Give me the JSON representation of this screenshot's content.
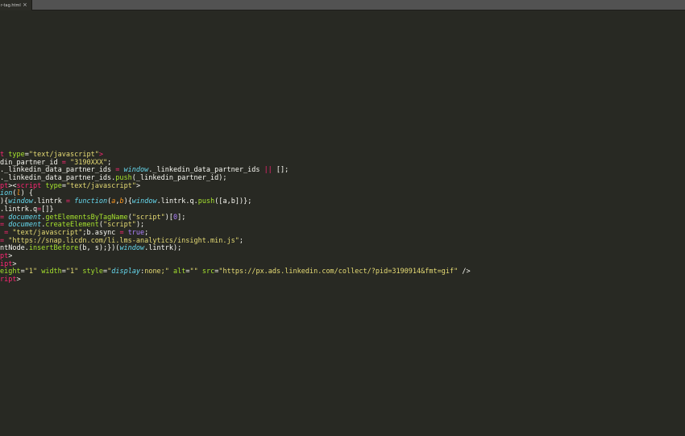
{
  "tab": {
    "label": "r-tag.html",
    "close_glyph": "×"
  },
  "code_lines": [
    [
      {
        "c": "tag",
        "t": "t"
      },
      {
        "c": "text",
        "t": " "
      },
      {
        "c": "attr",
        "t": "type"
      },
      {
        "c": "text",
        "t": "="
      },
      {
        "c": "str",
        "t": "\"text/javascript\""
      },
      {
        "c": "tag",
        "t": ">"
      }
    ],
    [
      {
        "c": "text",
        "t": "din_partner_id "
      },
      {
        "c": "op",
        "t": "="
      },
      {
        "c": "text",
        "t": " "
      },
      {
        "c": "str",
        "t": "\"3190XXX\""
      },
      {
        "c": "text",
        "t": ";"
      }
    ],
    [
      {
        "c": "text",
        "t": "._linkedin_data_partner_ids "
      },
      {
        "c": "op",
        "t": "="
      },
      {
        "c": "text",
        "t": " "
      },
      {
        "c": "global",
        "t": "window"
      },
      {
        "c": "text",
        "t": "._linkedin_data_partner_ids "
      },
      {
        "c": "op",
        "t": "||"
      },
      {
        "c": "text",
        "t": " [];"
      }
    ],
    [
      {
        "c": "text",
        "t": "._linkedin_data_partner_ids."
      },
      {
        "c": "func",
        "t": "push"
      },
      {
        "c": "text",
        "t": "(_linkedin_partner_id);"
      }
    ],
    [
      {
        "c": "tag",
        "t": "pt"
      },
      {
        "c": "text",
        "t": "><"
      },
      {
        "c": "tag",
        "t": "script"
      },
      {
        "c": "text",
        "t": " "
      },
      {
        "c": "attr",
        "t": "type"
      },
      {
        "c": "text",
        "t": "="
      },
      {
        "c": "str",
        "t": "\"text/javascript\""
      },
      {
        "c": "text",
        "t": ">"
      }
    ],
    [
      {
        "c": "kw",
        "t": "ion"
      },
      {
        "c": "text",
        "t": "("
      },
      {
        "c": "param",
        "t": "l"
      },
      {
        "c": "text",
        "t": ") {"
      }
    ],
    [
      {
        "c": "text",
        "t": "){"
      },
      {
        "c": "global",
        "t": "window"
      },
      {
        "c": "text",
        "t": ".lintrk "
      },
      {
        "c": "op",
        "t": "="
      },
      {
        "c": "text",
        "t": " "
      },
      {
        "c": "kw",
        "t": "function"
      },
      {
        "c": "text",
        "t": "("
      },
      {
        "c": "param",
        "t": "a"
      },
      {
        "c": "text",
        "t": ","
      },
      {
        "c": "param",
        "t": "b"
      },
      {
        "c": "text",
        "t": "){"
      },
      {
        "c": "global",
        "t": "window"
      },
      {
        "c": "text",
        "t": ".lintrk.q."
      },
      {
        "c": "func",
        "t": "push"
      },
      {
        "c": "text",
        "t": "([a,b])};"
      }
    ],
    [
      {
        "c": "text",
        "t": ".lintrk.q"
      },
      {
        "c": "op",
        "t": "="
      },
      {
        "c": "text",
        "t": "[]}"
      }
    ],
    [
      {
        "c": "op",
        "t": "="
      },
      {
        "c": "text",
        "t": " "
      },
      {
        "c": "global",
        "t": "document"
      },
      {
        "c": "text",
        "t": "."
      },
      {
        "c": "func",
        "t": "getElementsByTagName"
      },
      {
        "c": "text",
        "t": "("
      },
      {
        "c": "str",
        "t": "\"script\""
      },
      {
        "c": "text",
        "t": ")["
      },
      {
        "c": "num",
        "t": "0"
      },
      {
        "c": "text",
        "t": "];"
      }
    ],
    [
      {
        "c": "op",
        "t": "="
      },
      {
        "c": "text",
        "t": " "
      },
      {
        "c": "global",
        "t": "document"
      },
      {
        "c": "text",
        "t": "."
      },
      {
        "c": "func",
        "t": "createElement"
      },
      {
        "c": "text",
        "t": "("
      },
      {
        "c": "str",
        "t": "\"script\""
      },
      {
        "c": "text",
        "t": ");"
      }
    ],
    [
      {
        "c": "text",
        "t": " "
      },
      {
        "c": "op",
        "t": "="
      },
      {
        "c": "text",
        "t": " "
      },
      {
        "c": "str",
        "t": "\"text/javascript\""
      },
      {
        "c": "text",
        "t": ";b.async "
      },
      {
        "c": "op",
        "t": "="
      },
      {
        "c": "text",
        "t": " "
      },
      {
        "c": "bool",
        "t": "true"
      },
      {
        "c": "text",
        "t": ";"
      }
    ],
    [
      {
        "c": "op",
        "t": "="
      },
      {
        "c": "text",
        "t": " "
      },
      {
        "c": "str",
        "t": "\"https://snap.licdn.com/li.lms-analytics/insight.min.js\""
      },
      {
        "c": "text",
        "t": ";"
      }
    ],
    [
      {
        "c": "text",
        "t": "ntNode."
      },
      {
        "c": "func",
        "t": "insertBefore"
      },
      {
        "c": "text",
        "t": "(b, s);})("
      },
      {
        "c": "global",
        "t": "window"
      },
      {
        "c": "text",
        "t": ".lintrk);"
      }
    ],
    [
      {
        "c": "tag",
        "t": "pt"
      },
      {
        "c": "text",
        "t": ">"
      }
    ],
    [
      {
        "c": "tag",
        "t": "ipt"
      },
      {
        "c": "text",
        "t": ">"
      }
    ],
    [
      {
        "c": "attr",
        "t": "eight"
      },
      {
        "c": "text",
        "t": "="
      },
      {
        "c": "str",
        "t": "\"1\""
      },
      {
        "c": "text",
        "t": " "
      },
      {
        "c": "attr",
        "t": "width"
      },
      {
        "c": "text",
        "t": "="
      },
      {
        "c": "str",
        "t": "\"1\""
      },
      {
        "c": "text",
        "t": " "
      },
      {
        "c": "attr",
        "t": "style"
      },
      {
        "c": "text",
        "t": "="
      },
      {
        "c": "str",
        "t": "\""
      },
      {
        "c": "global",
        "t": "display"
      },
      {
        "c": "text",
        "t": ":"
      },
      {
        "c": "str",
        "t": "none;\""
      },
      {
        "c": "text",
        "t": " "
      },
      {
        "c": "attr",
        "t": "alt"
      },
      {
        "c": "text",
        "t": "="
      },
      {
        "c": "str",
        "t": "\"\""
      },
      {
        "c": "text",
        "t": " "
      },
      {
        "c": "attr",
        "t": "src"
      },
      {
        "c": "text",
        "t": "="
      },
      {
        "c": "str",
        "t": "\"https://px.ads.linkedin.com/collect/?pid=3190914&fmt=gif\""
      },
      {
        "c": "text",
        "t": " />"
      }
    ],
    [
      {
        "c": "tag",
        "t": "ript"
      },
      {
        "c": "text",
        "t": ">"
      }
    ]
  ]
}
